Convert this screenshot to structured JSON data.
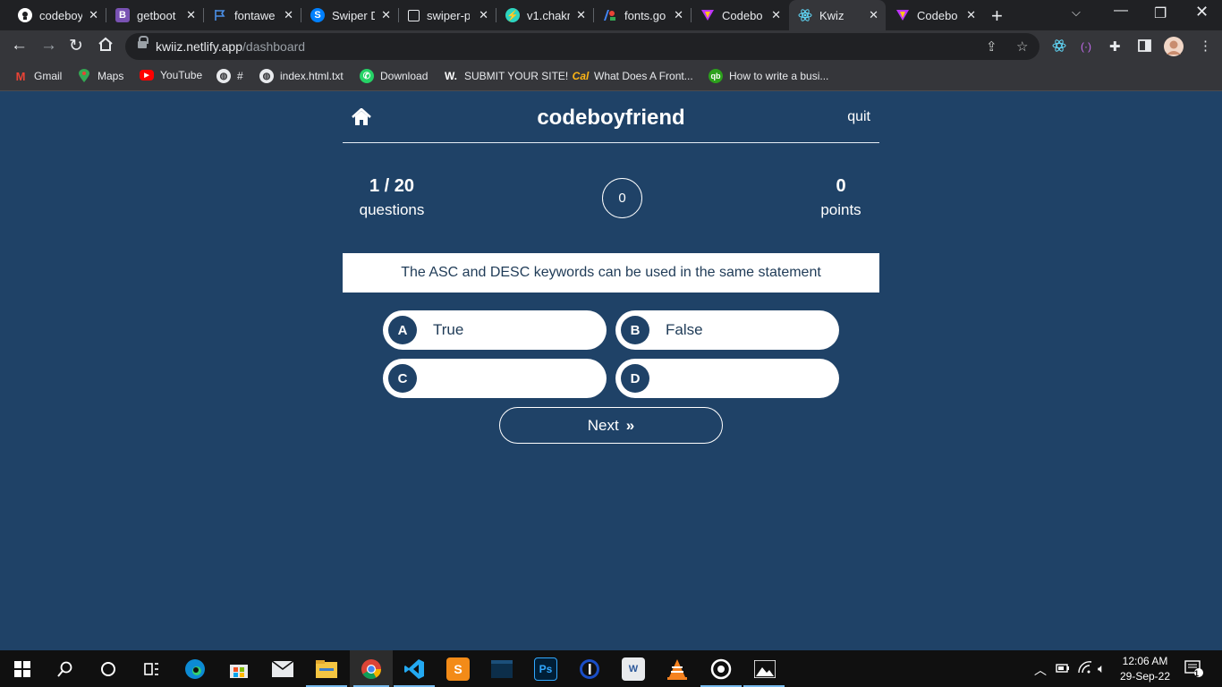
{
  "browser": {
    "tabs": [
      {
        "title": "codeboy",
        "icon": "github-icon",
        "color": "#ffffff"
      },
      {
        "title": "getboot",
        "icon": "bootstrap-icon",
        "color": "#7952b3"
      },
      {
        "title": "fontawe",
        "icon": "flag-icon",
        "color": "#4a8fe7"
      },
      {
        "title": "Swiper D",
        "icon": "swiper-icon",
        "color": "#0080ff"
      },
      {
        "title": "swiper-p",
        "icon": "square-icon",
        "color": "#ffffff"
      },
      {
        "title": "v1.chakr",
        "icon": "chakra-icon",
        "color": "#2dd4bf"
      },
      {
        "title": "fonts.go",
        "icon": "google-fonts-icon",
        "color": "#34a853"
      },
      {
        "title": "Codebo",
        "icon": "vite-icon",
        "color": "#bd34fe"
      },
      {
        "title": "Kwiz",
        "icon": "react-icon",
        "color": "#61dafb",
        "active": true
      },
      {
        "title": "Codebo",
        "icon": "vite-icon",
        "color": "#bd34fe"
      }
    ],
    "url_host": "kwiiz.netlify.app",
    "url_path": "/dashboard",
    "bookmarks": [
      {
        "label": "Gmail",
        "icon": "gmail-icon",
        "color": "#ea4335"
      },
      {
        "label": "Maps",
        "icon": "maps-icon",
        "color": "#34a853"
      },
      {
        "label": "YouTube",
        "icon": "youtube-icon",
        "color": "#ff0000"
      },
      {
        "label": "#",
        "icon": "globe-icon",
        "color": "#e8eaed"
      },
      {
        "label": "index.html.txt",
        "icon": "globe-icon",
        "color": "#e8eaed"
      },
      {
        "label": "Download",
        "icon": "whatsapp-icon",
        "color": "#25d366"
      },
      {
        "label": "SUBMIT YOUR SITE!",
        "icon": "w-icon",
        "color": "#ffffff"
      },
      {
        "label": "What Does A Front...",
        "icon": "cal-icon",
        "color": "#fdb515"
      },
      {
        "label": "How to write a busi...",
        "icon": "qb-icon",
        "color": "#2ca01c"
      }
    ]
  },
  "quiz": {
    "brand": "codeboyfriend",
    "quit": "quit",
    "progress": "1 / 20",
    "progress_label": "questions",
    "timer": "0",
    "points": "0",
    "points_label": "points",
    "question": "The ASC and DESC keywords can be used in the same statement",
    "options": [
      {
        "letter": "A",
        "text": "True"
      },
      {
        "letter": "B",
        "text": "False"
      },
      {
        "letter": "C",
        "text": ""
      },
      {
        "letter": "D",
        "text": ""
      }
    ],
    "next_label": "Next"
  },
  "taskbar": {
    "time": "12:06 AM",
    "date": "29-Sep-22",
    "notification_count": "1",
    "apps": [
      "start-icon",
      "search-icon",
      "cortana-icon",
      "task-view-icon",
      "edge-icon",
      "store-icon",
      "mail-icon",
      "file-explorer-icon",
      "chrome-icon",
      "vscode-icon",
      "sublime-icon",
      "terminal-icon",
      "photoshop-icon",
      "app-1-icon",
      "word-icon",
      "vlc-icon",
      "obs-icon",
      "photos-icon"
    ]
  },
  "colors": {
    "app_background": "#1f4267",
    "question_text": "#1f3b57",
    "chrome_dark": "#202124",
    "chrome_toolbar": "#35363a"
  }
}
